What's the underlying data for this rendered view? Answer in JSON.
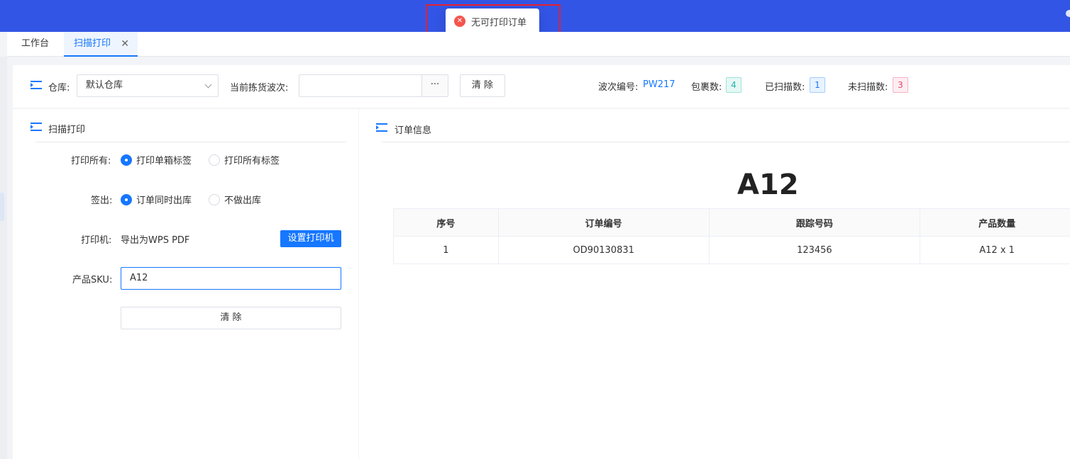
{
  "toast": {
    "message": "无可打印订单",
    "icon": "error-circle-icon"
  },
  "tabs": [
    {
      "label": "工作台"
    },
    {
      "label": "扫描打印",
      "close": "✕"
    }
  ],
  "filter": {
    "warehouse_label": "仓库:",
    "warehouse_value": "默认仓库",
    "wave_label": "当前拣货波次:",
    "wave_value": "",
    "ellipsis": "···",
    "clear_label": "清 除",
    "wave_no_label": "波次编号:",
    "wave_no_value": "PW217",
    "package_label": "包裹数:",
    "package_count": "4",
    "scanned_label": "已扫描数:",
    "scanned_count": "1",
    "unscanned_label": "未扫描数:",
    "unscanned_count": "3"
  },
  "scan": {
    "title": "扫描打印",
    "print_all_label": "打印所有:",
    "print_all_options": [
      "打印单箱标签",
      "打印所有标签"
    ],
    "print_all_selected": 0,
    "checkout_label": "签出:",
    "checkout_options": [
      "订单同时出库",
      "不做出库"
    ],
    "checkout_selected": 0,
    "printer_label": "打印机:",
    "printer_value": "导出为WPS PDF",
    "set_printer": "设置打印机",
    "sku_label": "产品SKU:",
    "sku_value": "A12",
    "clear_label": "清 除"
  },
  "order": {
    "title": "订单信息",
    "heading": "A12",
    "columns": [
      "序号",
      "订单编号",
      "跟踪号码",
      "产品数量"
    ],
    "rows": [
      [
        "1",
        "OD90130831",
        "123456",
        "A12 x 1"
      ]
    ]
  },
  "colors": {
    "accent": "#1677ff",
    "topbar": "#3355e6",
    "error": "#f5544c"
  }
}
